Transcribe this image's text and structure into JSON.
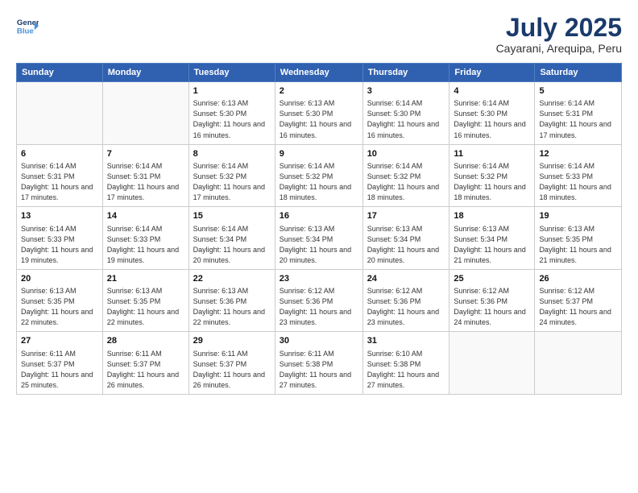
{
  "logo": {
    "line1": "General",
    "line2": "Blue"
  },
  "title": "July 2025",
  "subtitle": "Cayarani, Arequipa, Peru",
  "weekdays": [
    "Sunday",
    "Monday",
    "Tuesday",
    "Wednesday",
    "Thursday",
    "Friday",
    "Saturday"
  ],
  "weeks": [
    [
      {
        "day": "",
        "info": ""
      },
      {
        "day": "",
        "info": ""
      },
      {
        "day": "1",
        "info": "Sunrise: 6:13 AM\nSunset: 5:30 PM\nDaylight: 11 hours and 16 minutes."
      },
      {
        "day": "2",
        "info": "Sunrise: 6:13 AM\nSunset: 5:30 PM\nDaylight: 11 hours and 16 minutes."
      },
      {
        "day": "3",
        "info": "Sunrise: 6:14 AM\nSunset: 5:30 PM\nDaylight: 11 hours and 16 minutes."
      },
      {
        "day": "4",
        "info": "Sunrise: 6:14 AM\nSunset: 5:30 PM\nDaylight: 11 hours and 16 minutes."
      },
      {
        "day": "5",
        "info": "Sunrise: 6:14 AM\nSunset: 5:31 PM\nDaylight: 11 hours and 17 minutes."
      }
    ],
    [
      {
        "day": "6",
        "info": "Sunrise: 6:14 AM\nSunset: 5:31 PM\nDaylight: 11 hours and 17 minutes."
      },
      {
        "day": "7",
        "info": "Sunrise: 6:14 AM\nSunset: 5:31 PM\nDaylight: 11 hours and 17 minutes."
      },
      {
        "day": "8",
        "info": "Sunrise: 6:14 AM\nSunset: 5:32 PM\nDaylight: 11 hours and 17 minutes."
      },
      {
        "day": "9",
        "info": "Sunrise: 6:14 AM\nSunset: 5:32 PM\nDaylight: 11 hours and 18 minutes."
      },
      {
        "day": "10",
        "info": "Sunrise: 6:14 AM\nSunset: 5:32 PM\nDaylight: 11 hours and 18 minutes."
      },
      {
        "day": "11",
        "info": "Sunrise: 6:14 AM\nSunset: 5:32 PM\nDaylight: 11 hours and 18 minutes."
      },
      {
        "day": "12",
        "info": "Sunrise: 6:14 AM\nSunset: 5:33 PM\nDaylight: 11 hours and 18 minutes."
      }
    ],
    [
      {
        "day": "13",
        "info": "Sunrise: 6:14 AM\nSunset: 5:33 PM\nDaylight: 11 hours and 19 minutes."
      },
      {
        "day": "14",
        "info": "Sunrise: 6:14 AM\nSunset: 5:33 PM\nDaylight: 11 hours and 19 minutes."
      },
      {
        "day": "15",
        "info": "Sunrise: 6:14 AM\nSunset: 5:34 PM\nDaylight: 11 hours and 20 minutes."
      },
      {
        "day": "16",
        "info": "Sunrise: 6:13 AM\nSunset: 5:34 PM\nDaylight: 11 hours and 20 minutes."
      },
      {
        "day": "17",
        "info": "Sunrise: 6:13 AM\nSunset: 5:34 PM\nDaylight: 11 hours and 20 minutes."
      },
      {
        "day": "18",
        "info": "Sunrise: 6:13 AM\nSunset: 5:34 PM\nDaylight: 11 hours and 21 minutes."
      },
      {
        "day": "19",
        "info": "Sunrise: 6:13 AM\nSunset: 5:35 PM\nDaylight: 11 hours and 21 minutes."
      }
    ],
    [
      {
        "day": "20",
        "info": "Sunrise: 6:13 AM\nSunset: 5:35 PM\nDaylight: 11 hours and 22 minutes."
      },
      {
        "day": "21",
        "info": "Sunrise: 6:13 AM\nSunset: 5:35 PM\nDaylight: 11 hours and 22 minutes."
      },
      {
        "day": "22",
        "info": "Sunrise: 6:13 AM\nSunset: 5:36 PM\nDaylight: 11 hours and 22 minutes."
      },
      {
        "day": "23",
        "info": "Sunrise: 6:12 AM\nSunset: 5:36 PM\nDaylight: 11 hours and 23 minutes."
      },
      {
        "day": "24",
        "info": "Sunrise: 6:12 AM\nSunset: 5:36 PM\nDaylight: 11 hours and 23 minutes."
      },
      {
        "day": "25",
        "info": "Sunrise: 6:12 AM\nSunset: 5:36 PM\nDaylight: 11 hours and 24 minutes."
      },
      {
        "day": "26",
        "info": "Sunrise: 6:12 AM\nSunset: 5:37 PM\nDaylight: 11 hours and 24 minutes."
      }
    ],
    [
      {
        "day": "27",
        "info": "Sunrise: 6:11 AM\nSunset: 5:37 PM\nDaylight: 11 hours and 25 minutes."
      },
      {
        "day": "28",
        "info": "Sunrise: 6:11 AM\nSunset: 5:37 PM\nDaylight: 11 hours and 26 minutes."
      },
      {
        "day": "29",
        "info": "Sunrise: 6:11 AM\nSunset: 5:37 PM\nDaylight: 11 hours and 26 minutes."
      },
      {
        "day": "30",
        "info": "Sunrise: 6:11 AM\nSunset: 5:38 PM\nDaylight: 11 hours and 27 minutes."
      },
      {
        "day": "31",
        "info": "Sunrise: 6:10 AM\nSunset: 5:38 PM\nDaylight: 11 hours and 27 minutes."
      },
      {
        "day": "",
        "info": ""
      },
      {
        "day": "",
        "info": ""
      }
    ]
  ]
}
